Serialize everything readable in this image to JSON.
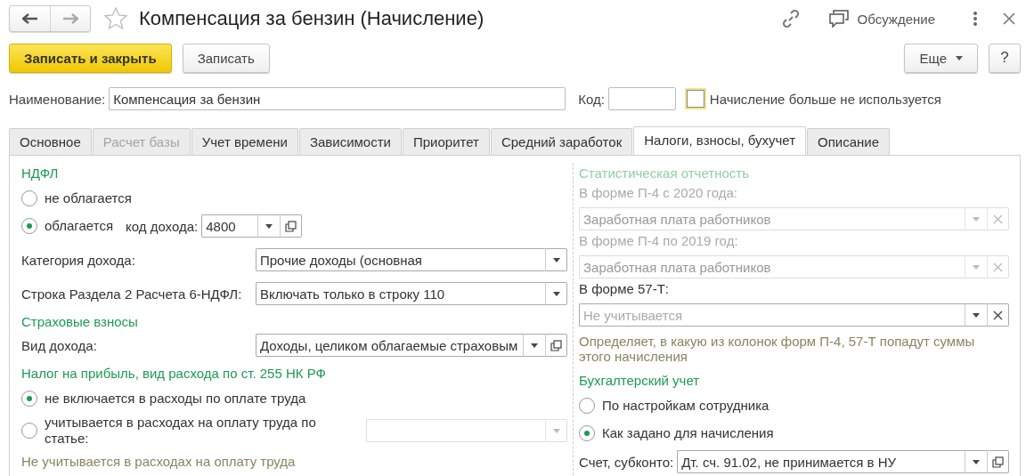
{
  "window": {
    "title": "Компенсация за бензин (Начисление)",
    "discussion": "Обсуждение"
  },
  "toolbar": {
    "buttons": [
      {
        "label": "Записать и закрыть",
        "kind": "primary"
      },
      {
        "label": "Записать",
        "kind": "normal"
      }
    ],
    "more": "Еще",
    "help": "?"
  },
  "header": {
    "name_label": "Наименование:",
    "name_value": "Компенсация за бензин",
    "code_label": "Код:",
    "inactive": {
      "label": "Начисление больше не используется",
      "checked": false
    }
  },
  "tabs": [
    {
      "label": "Основное",
      "selected": false,
      "disabled": false
    },
    {
      "label": "Расчет базы",
      "selected": false,
      "disabled": true
    },
    {
      "label": "Учет времени",
      "selected": false,
      "disabled": false
    },
    {
      "label": "Зависимости",
      "selected": false,
      "disabled": false
    },
    {
      "label": "Приоритет",
      "selected": false,
      "disabled": false
    },
    {
      "label": "Средний заработок",
      "selected": false,
      "disabled": false
    },
    {
      "label": "Налоги, взносы, бухучет",
      "selected": true,
      "disabled": false
    },
    {
      "label": "Описание",
      "selected": false,
      "disabled": false
    }
  ],
  "left": {
    "items": [
      {
        "kind": "heading",
        "text": "НДФЛ",
        "disabled": false
      },
      {
        "kind": "radio",
        "text": "не облагается",
        "selected": false
      },
      {
        "kind": "radio",
        "text": "облагается",
        "selected": true,
        "field": {
          "label": "код дохода:",
          "value": "4800",
          "disabled": false,
          "open": true
        }
      },
      {
        "kind": "field",
        "field": {
          "label": "Категория дохода:",
          "value": "Прочие доходы (основная",
          "disabled": false
        }
      },
      {
        "kind": "field",
        "field": {
          "label": "Строка Раздела 2 Расчета 6-НДФЛ:",
          "value": "Включать только в строку 110",
          "disabled": false
        }
      },
      {
        "kind": "heading",
        "text": "Страховые взносы",
        "disabled": false
      },
      {
        "kind": "field",
        "field": {
          "label": "Вид дохода:",
          "value": "Доходы, целиком облагаемые страховым",
          "disabled": false,
          "open": true
        }
      },
      {
        "kind": "heading",
        "text": "Налог на прибыль, вид расхода по ст. 255 НК РФ",
        "disabled": false
      },
      {
        "kind": "radio",
        "text": "не включается в расходы по оплате труда",
        "selected": true
      },
      {
        "kind": "radio",
        "text": "учитывается в расходах на оплату труда по статье:",
        "selected": false,
        "field": {
          "disabled": true
        }
      },
      {
        "kind": "note",
        "text": "Не учитывается в расходах на оплату труда"
      }
    ]
  },
  "right": {
    "items": [
      {
        "kind": "heading",
        "text": "Статистическая отчетность",
        "disabled": true
      },
      {
        "kind": "label",
        "text": "В форме П-4 с 2020 года:",
        "disabled": true
      },
      {
        "kind": "field",
        "field": {
          "value": "Заработная плата работников",
          "disabled": true,
          "clear": true
        }
      },
      {
        "kind": "label",
        "text": "В форме П-4 по 2019 год:",
        "disabled": true
      },
      {
        "kind": "field",
        "field": {
          "value": "Заработная плата работников",
          "disabled": true,
          "clear": true
        }
      },
      {
        "kind": "label",
        "text": "В форме 57-Т:",
        "disabled": false
      },
      {
        "kind": "field",
        "field": {
          "placeholder": "Не учитывается",
          "disabled": false,
          "clear": true
        }
      },
      {
        "kind": "note",
        "text": "Определяет, в какую из колонок форм П-4, 57-Т попадут суммы этого начисления"
      },
      {
        "kind": "heading",
        "text": "Бухгалтерский учет",
        "disabled": false
      },
      {
        "kind": "radio",
        "text": "По настройкам сотрудника",
        "selected": false
      },
      {
        "kind": "radio",
        "text": "Как задано для начисления",
        "selected": true
      },
      {
        "kind": "field",
        "field": {
          "label": "Счет, субконто:",
          "value": "Дт. сч. 91.02, не принимается в НУ",
          "disabled": false,
          "open": true
        }
      }
    ]
  }
}
